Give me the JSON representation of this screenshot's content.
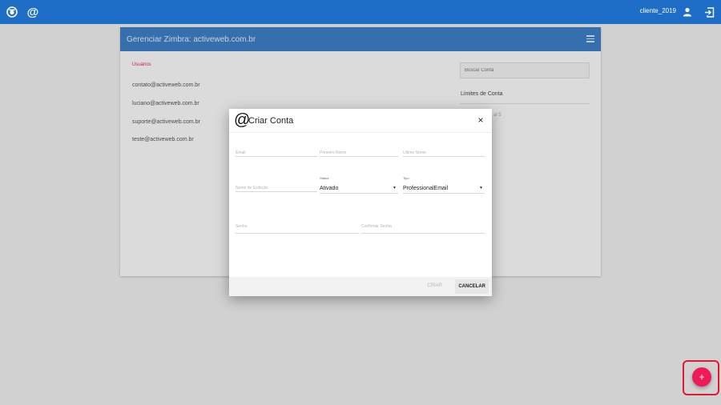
{
  "topbar": {
    "username": "cliente_2019",
    "icons": [
      "app-logo-icon",
      "at-icon",
      "user-icon",
      "logout-icon"
    ],
    "color": "#1e6ec7"
  },
  "card": {
    "title": "Gerenciar Zimbra: activeweb.com.br",
    "section_title": "Usuários",
    "users": [
      "contato@activeweb.com.br",
      "luciano@activeweb.com.br",
      "suporte@activeweb.com.br",
      "teste@activeweb.com.br"
    ],
    "search_placeholder": "Buscar Conta",
    "limits_title": "Limites de Conta",
    "limits_value": "al 5"
  },
  "dialog": {
    "at_symbol": "@",
    "title": "Criar Conta",
    "close_glyph": "×",
    "fields": {
      "email_placeholder": "Email",
      "first_name_placeholder": "Primeiro Nome",
      "last_name_placeholder": "Último Nome",
      "display_name_placeholder": "Nome de Exibição",
      "status_label": "Status",
      "status_value": "Ativado",
      "type_label": "Tipo",
      "type_value": "ProfessionalEmail",
      "password_placeholder": "Senha",
      "confirm_password_placeholder": "Confirmar Senha"
    },
    "buttons": {
      "create": "CRIAR",
      "cancel": "CANCELAR"
    }
  },
  "fab": {
    "label": "+",
    "color": "#f01b56"
  }
}
